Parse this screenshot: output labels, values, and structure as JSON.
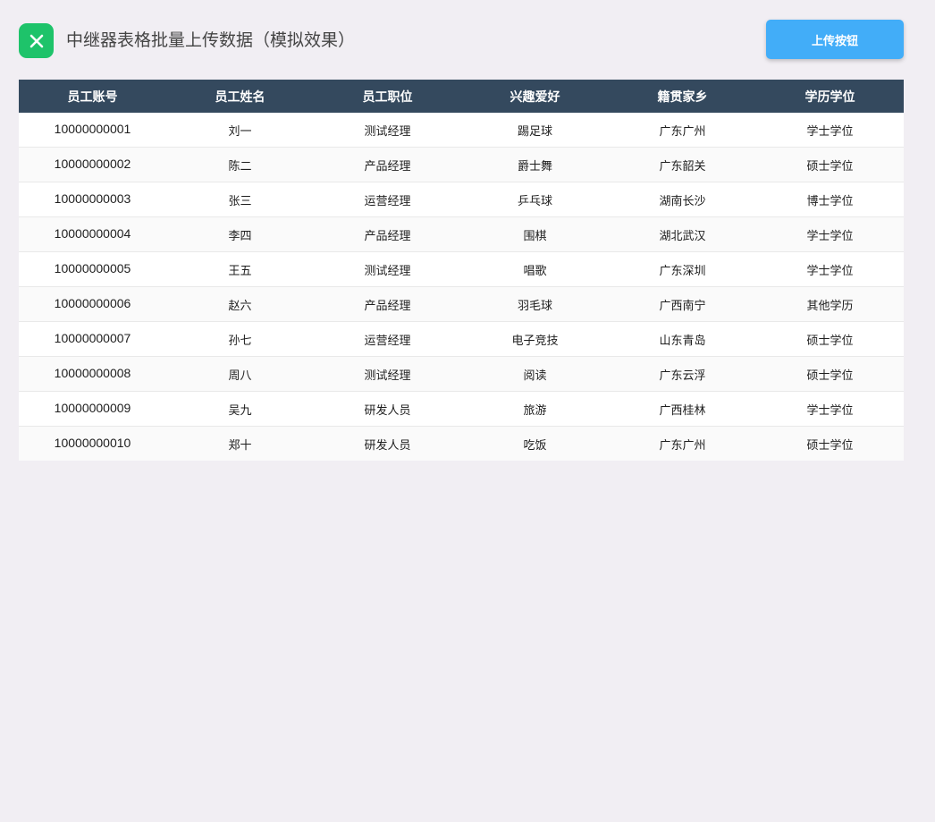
{
  "app": {
    "title": "中继器表格批量上传数据（模拟效果）",
    "icon": "close-x-icon",
    "icon_color": "#1ec36a"
  },
  "toolbar": {
    "upload_label": "上传按钮",
    "button_color": "#42adf8"
  },
  "table": {
    "header_color": "#34495e",
    "columns": [
      "员工账号",
      "员工姓名",
      "员工职位",
      "兴趣爱好",
      "籍贯家乡",
      "学历学位"
    ],
    "rows": [
      [
        "10000000001",
        "刘一",
        "测试经理",
        "踢足球",
        "广东广州",
        "学士学位"
      ],
      [
        "10000000002",
        "陈二",
        "产品经理",
        "爵士舞",
        "广东韶关",
        "硕士学位"
      ],
      [
        "10000000003",
        "张三",
        "运营经理",
        "乒乓球",
        "湖南长沙",
        "博士学位"
      ],
      [
        "10000000004",
        "李四",
        "产品经理",
        "围棋",
        "湖北武汉",
        "学士学位"
      ],
      [
        "10000000005",
        "王五",
        "测试经理",
        "唱歌",
        "广东深圳",
        "学士学位"
      ],
      [
        "10000000006",
        "赵六",
        "产品经理",
        "羽毛球",
        "广西南宁",
        "其他学历"
      ],
      [
        "10000000007",
        "孙七",
        "运营经理",
        "电子竞技",
        "山东青岛",
        "硕士学位"
      ],
      [
        "10000000008",
        "周八",
        "测试经理",
        "阅读",
        "广东云浮",
        "硕士学位"
      ],
      [
        "10000000009",
        "吴九",
        "研发人员",
        "旅游",
        "广西桂林",
        "学士学位"
      ],
      [
        "10000000010",
        "郑十",
        "研发人员",
        "吃饭",
        "广东广州",
        "硕士学位"
      ]
    ]
  }
}
